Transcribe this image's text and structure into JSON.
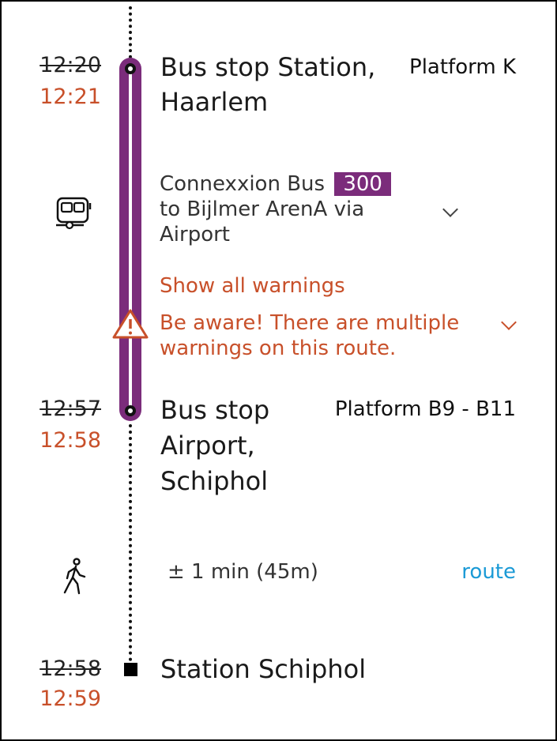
{
  "stops": [
    {
      "scheduled_time": "12:20",
      "actual_time": "12:21",
      "name_line1": "Bus stop Station,",
      "name_line2": "Haarlem",
      "platform": "Platform K"
    },
    {
      "scheduled_time": "12:57",
      "actual_time": "12:58",
      "name_line1": "Bus stop",
      "name_line2": "Airport,",
      "name_line3": "Schiphol",
      "platform": "Platform B9 - B11"
    },
    {
      "scheduled_time": "12:58",
      "actual_time": "12:59",
      "name_line1": "Station Schiphol"
    }
  ],
  "leg": {
    "operator": "Connexxion Bus",
    "line_number": "300",
    "direction_line1": "to Bijlmer ArenA via",
    "direction_line2": "Airport",
    "icon": "bus-icon"
  },
  "warnings": {
    "link_label": "Show all warnings",
    "message_line1": "Be aware! There are multiple",
    "message_line2": "warnings on this route.",
    "icon": "warning-triangle-icon"
  },
  "walk": {
    "duration": "± 1 min (45m)",
    "route_label": "route",
    "icon": "walking-person-icon"
  },
  "colors": {
    "line": "#7b2c7b",
    "delay": "#c8502a",
    "link": "#1b9ad6"
  }
}
